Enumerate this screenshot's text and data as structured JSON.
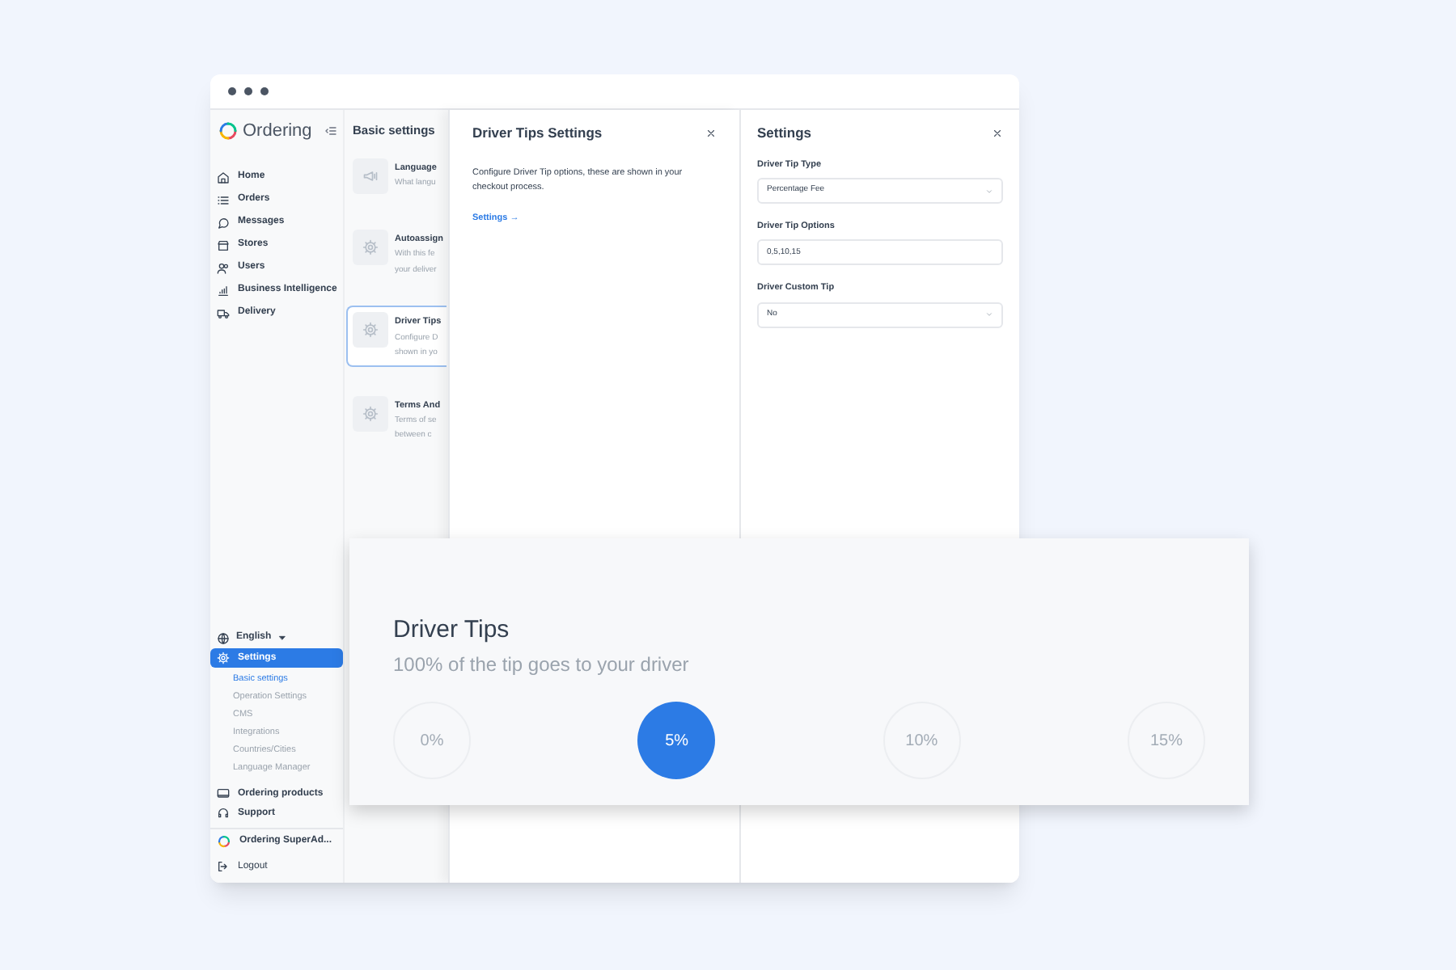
{
  "brand": {
    "name": "Ordering"
  },
  "sidebar": {
    "nav": [
      {
        "label": "Home"
      },
      {
        "label": "Orders"
      },
      {
        "label": "Messages"
      },
      {
        "label": "Stores"
      },
      {
        "label": "Users"
      },
      {
        "label": "Business Intelligence"
      },
      {
        "label": "Delivery"
      }
    ],
    "language": "English",
    "settings": {
      "label": "Settings",
      "selected": true,
      "children": [
        {
          "label": "Basic settings",
          "selected": true
        },
        {
          "label": "Operation Settings",
          "selected": false
        },
        {
          "label": "CMS",
          "selected": false
        },
        {
          "label": "Integrations",
          "selected": false
        },
        {
          "label": "Countries/Cities",
          "selected": false
        },
        {
          "label": "Language Manager",
          "selected": false
        }
      ]
    },
    "bottom": [
      {
        "label": "Ordering products"
      },
      {
        "label": "Support"
      }
    ],
    "account": "Ordering SuperAd...",
    "logout": "Logout"
  },
  "basic_settings": {
    "title": "Basic settings",
    "items": [
      {
        "title": "Language",
        "description": [
          "What langu"
        ],
        "selected": false,
        "kind": "language"
      },
      {
        "title": "Autoassign",
        "description": [
          "With this fe",
          "your deliver"
        ],
        "selected": false,
        "kind": "gear"
      },
      {
        "title": "Driver Tips",
        "description": [
          "Configure D",
          "shown in yo"
        ],
        "selected": true,
        "kind": "gear"
      },
      {
        "title": "Terms And",
        "description": [
          "Terms of se",
          "between c"
        ],
        "selected": false,
        "kind": "gear"
      }
    ]
  },
  "driver_tips_panel": {
    "title": "Driver Tips Settings",
    "description": "Configure Driver Tip options, these are shown in your checkout process.",
    "link": "Settings →"
  },
  "settings_panel": {
    "title": "Settings",
    "fields": [
      {
        "label": "Driver Tip Type",
        "kind": "select",
        "value": "Percentage Fee"
      },
      {
        "label": "Driver Tip Options",
        "kind": "input",
        "value": "0,5,10,15"
      },
      {
        "label": "Driver Custom Tip",
        "kind": "select",
        "value": "No"
      }
    ]
  },
  "tips_card": {
    "title": "Driver Tips",
    "subtitle": "100% of the tip goes to your driver",
    "options": [
      {
        "label": "0%",
        "selected": false
      },
      {
        "label": "5%",
        "selected": true
      },
      {
        "label": "10%",
        "selected": false
      },
      {
        "label": "15%",
        "selected": false
      }
    ]
  }
}
